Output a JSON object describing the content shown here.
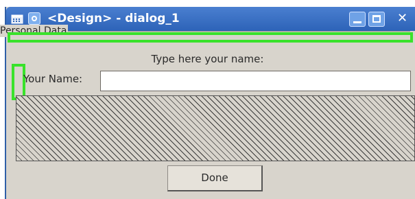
{
  "window": {
    "title": "<Design> - dialog_1",
    "icons": [
      "menu-icon",
      "app-icon",
      "minimize-icon",
      "maximize-icon",
      "close-icon"
    ],
    "close_glyph": "✕"
  },
  "group": {
    "label": "Personal Data"
  },
  "form": {
    "hint_text": "Type here your name:",
    "name_label": "Your Name:",
    "name_value": ""
  },
  "buttons": {
    "done_label": "Done"
  },
  "colors": {
    "titlebar": "#2d63b8",
    "selection": "#39e22b",
    "background": "#d8d4cc"
  }
}
